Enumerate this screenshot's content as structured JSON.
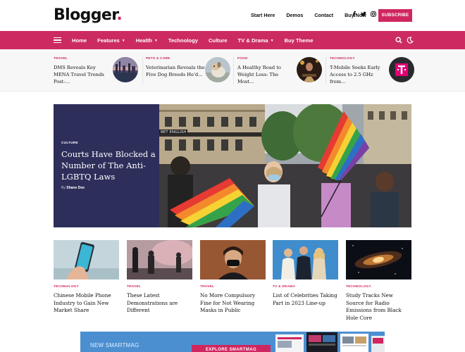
{
  "brand": {
    "name": "Blogger",
    "dot": ".",
    "accent": "#d0265f",
    "nav_color": "#cc2b61",
    "hero_panel": "#2d2e5a"
  },
  "header": {
    "links": [
      "Start Here",
      "Demos",
      "Contact",
      "Buy Now"
    ],
    "social_icons": [
      "facebook-icon",
      "twitter-icon",
      "instagram-icon"
    ],
    "subscribe_label": "SUBSCRIBE"
  },
  "nav": {
    "items": [
      {
        "label": "Home",
        "dropdown": false
      },
      {
        "label": "Features",
        "dropdown": true
      },
      {
        "label": "Health",
        "dropdown": true
      },
      {
        "label": "Technology",
        "dropdown": false
      },
      {
        "label": "Culture",
        "dropdown": false
      },
      {
        "label": "TV & Drama",
        "dropdown": true
      },
      {
        "label": "Buy Theme",
        "dropdown": false
      }
    ],
    "icons": [
      "menu-icon",
      "search-icon",
      "moon-icon"
    ]
  },
  "trending": [
    {
      "category": "TRAVEL",
      "title": "DMS Reveals Key MENA Travel Trends Post-…"
    },
    {
      "category": "PETS & CARE",
      "title": "Veterinarian Reveals the Five Dog Breeds He'd…"
    },
    {
      "category": "FOOD",
      "title": "A Healthy Road to Weight Loss: The Most…"
    },
    {
      "category": "TECHNOLOGY",
      "title": "T-Mobile Seeks Early Access to 2.5 GHz from…"
    }
  ],
  "hero": {
    "category": "CULTURE",
    "title": "Courts Have Blocked a Number of The Anti-LGBTQ Laws",
    "by_prefix": "By",
    "author": "Shane Doe"
  },
  "cards": [
    {
      "category": "TECHNOLOGY",
      "title": "Chinese Mobile Phone Industry to Gain New Market Share"
    },
    {
      "category": "TRAVEL",
      "title": "These Latest Demonstrations are Different"
    },
    {
      "category": "TRAVEL",
      "title": "No More Compulsory Fine for Not Wearing Masks in Public"
    },
    {
      "category": "TV & DRAMA",
      "title": "List of Celebrities Taking Part in 2023 Line-up"
    },
    {
      "category": "TECHNOLOGY",
      "title": "Study Tracks New Source for Radio Emissions from Black Hole Core"
    }
  ],
  "banner": {
    "label": "NEW SMARTMAG",
    "button": "EXPLORE SMARTMAG"
  }
}
